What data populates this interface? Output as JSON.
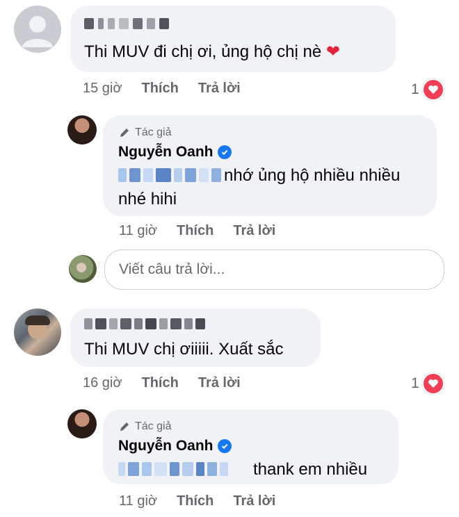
{
  "comments": [
    {
      "text": "Thi MUV đi chị ơi, ủng hộ chị nè",
      "time": "15 giờ",
      "like": "Thích",
      "reply": "Trả lời",
      "reaction_count": "1",
      "emoji": "❤️"
    },
    {
      "text": "Thi MUV chị ơiiiii. Xuất sắc",
      "time": "16 giờ",
      "like": "Thích",
      "reply": "Trả lời",
      "reaction_count": "1"
    }
  ],
  "replies": [
    {
      "badge": "Tác giả",
      "author": "Nguyễn Oanh",
      "line1": "nhớ ủng hộ nhiều nhiều",
      "line2": "nhé hihi",
      "time": "11 giờ",
      "like": "Thích",
      "reply": "Trả lời"
    },
    {
      "badge": "Tác giả",
      "author": "Nguyễn Oanh",
      "text": "thank em nhiều",
      "time": "11 giờ",
      "like": "Thích",
      "reply": "Trả lời"
    }
  ],
  "reply_box": {
    "placeholder": "Viết câu trả lời..."
  },
  "colors": {
    "heart": "#f33e58",
    "verified": "#1877f2",
    "bubble": "#f0f2f5",
    "meta": "#65676b"
  }
}
